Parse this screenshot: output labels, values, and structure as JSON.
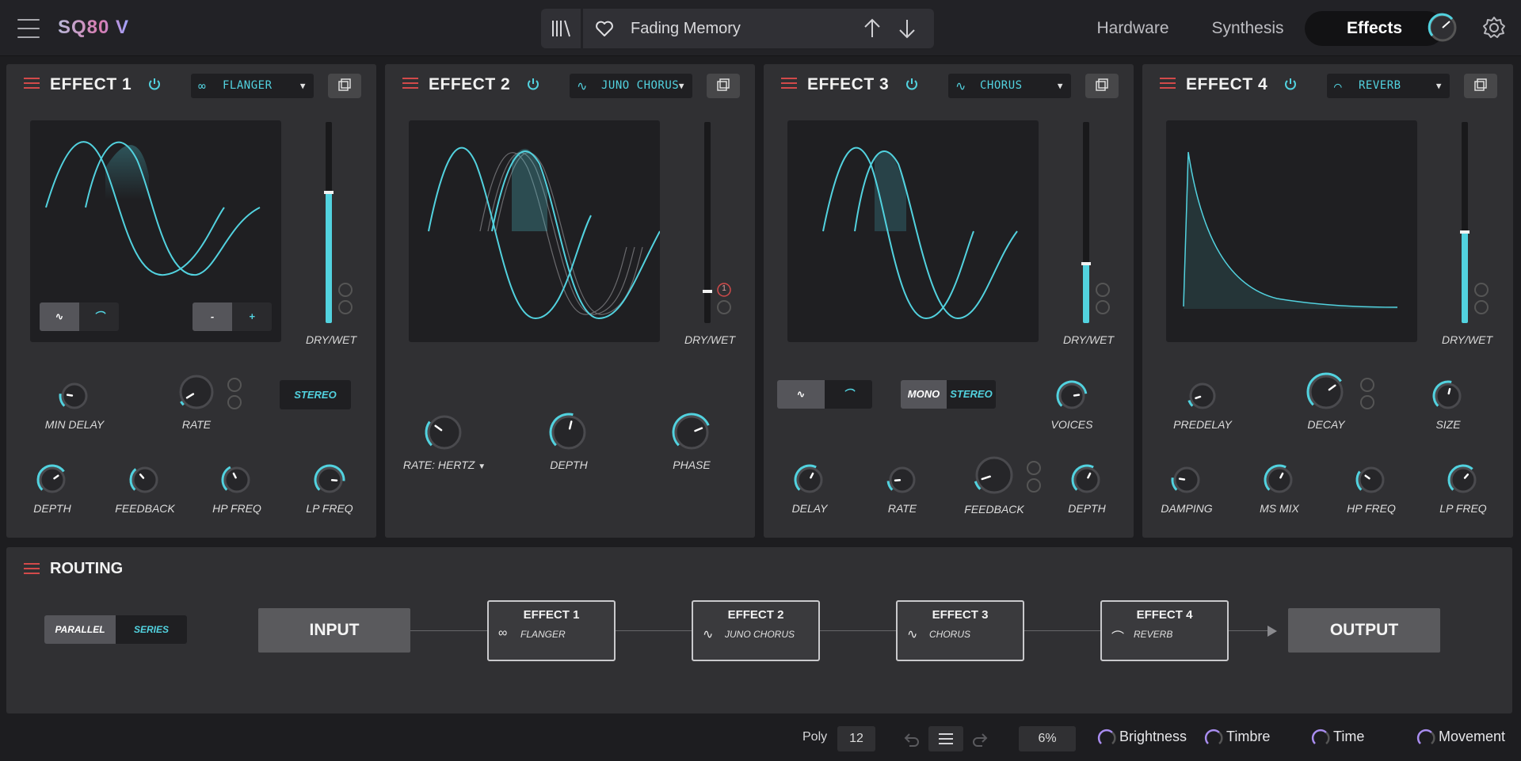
{
  "app": {
    "logo": "SQ80 V"
  },
  "header": {
    "preset_name": "Fading Memory",
    "tabs": [
      "Hardware",
      "Synthesis",
      "Effects"
    ],
    "active_tab": "Effects"
  },
  "effects": [
    {
      "title": "EFFECT 1",
      "type": "FLANGER",
      "type_icon": "infinity-icon",
      "drywet_label": "DRY/WET",
      "drywet": 0.62,
      "wave_buttons": [
        "sine-wave",
        "tri-wave"
      ],
      "minus": "-",
      "plus": "+",
      "stereo_label": "STEREO",
      "knobs_top": [
        {
          "label": "MIN DELAY",
          "value": 0.2
        },
        {
          "label": "RATE",
          "value": 0.05
        }
      ],
      "knobs_bottom": [
        {
          "label": "DEPTH",
          "value": 0.7
        },
        {
          "label": "FEEDBACK",
          "value": 0.35
        },
        {
          "label": "HP FREQ",
          "value": 0.4
        },
        {
          "label": "LP FREQ",
          "value": 0.85
        }
      ]
    },
    {
      "title": "EFFECT 2",
      "type": "JUNO CHORUS",
      "type_icon": "wave-icon",
      "drywet_label": "DRY/WET",
      "drywet": 0.15,
      "mod_badge": "1",
      "rate_label": "RATE: HERTZ",
      "knobs": [
        {
          "label": "RATE: HERTZ",
          "value": 0.3
        },
        {
          "label": "DEPTH",
          "value": 0.55
        },
        {
          "label": "PHASE",
          "value": 0.75
        }
      ]
    },
    {
      "title": "EFFECT 3",
      "type": "CHORUS",
      "type_icon": "wave-icon",
      "drywet_label": "DRY/WET",
      "drywet": 0.25,
      "mono_label": "MONO",
      "stereo_label": "STEREO",
      "knobs_top": [
        {
          "label": "VOICES",
          "value": 0.8
        }
      ],
      "knobs_bottom": [
        {
          "label": "DELAY",
          "value": 0.6
        },
        {
          "label": "RATE",
          "value": 0.15
        },
        {
          "label": "FEEDBACK",
          "value": 0.1
        },
        {
          "label": "DEPTH",
          "value": 0.6
        }
      ]
    },
    {
      "title": "EFFECT 4",
      "type": "REVERB",
      "type_icon": "reverb-icon",
      "drywet_label": "DRY/WET",
      "drywet": 0.38,
      "knobs_top": [
        {
          "label": "PREDELAY",
          "value": 0.1
        },
        {
          "label": "DECAY",
          "value": 0.7
        },
        {
          "label": "SIZE",
          "value": 0.55
        }
      ],
      "knobs_bottom": [
        {
          "label": "DAMPING",
          "value": 0.2
        },
        {
          "label": "MS MIX",
          "value": 0.6
        },
        {
          "label": "HP FREQ",
          "value": 0.3
        },
        {
          "label": "LP FREQ",
          "value": 0.65
        }
      ]
    }
  ],
  "routing": {
    "title": "ROUTING",
    "modes": [
      "PARALLEL",
      "SERIES"
    ],
    "active_mode": "SERIES",
    "input_label": "INPUT",
    "output_label": "OUTPUT",
    "chain": [
      {
        "title": "EFFECT 1",
        "sub": "FLANGER",
        "icon": "∞"
      },
      {
        "title": "EFFECT 2",
        "sub": "JUNO CHORUS",
        "icon": "∿"
      },
      {
        "title": "EFFECT 3",
        "sub": "CHORUS",
        "icon": "∿"
      },
      {
        "title": "EFFECT 4",
        "sub": "REVERB",
        "icon": "⌒"
      }
    ]
  },
  "status": {
    "poly_label": "Poly",
    "poly_value": "12",
    "zoom": "6%",
    "macros": [
      "Brightness",
      "Timbre",
      "Time",
      "Movement"
    ]
  },
  "colors": {
    "accent": "#52d2df",
    "macro": "#a98df0",
    "menu_red": "#d24a4a"
  }
}
